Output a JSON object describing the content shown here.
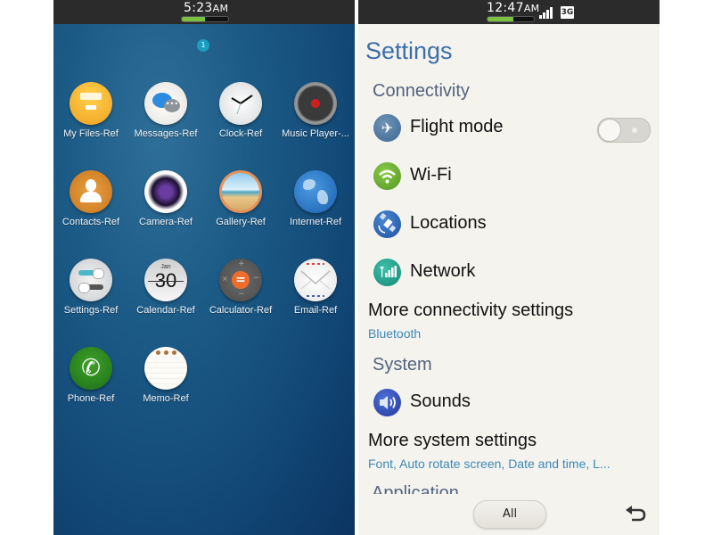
{
  "home_screen": {
    "status_bar": {
      "time": "5:23",
      "ampm": "AM",
      "battery_percent": 50
    },
    "page_indicator": "1",
    "apps": [
      {
        "label": "My Files-Ref",
        "icon": "folder-icon"
      },
      {
        "label": "Messages-Ref",
        "icon": "chat-bubbles-icon"
      },
      {
        "label": "Clock-Ref",
        "icon": "clock-icon"
      },
      {
        "label": "Music Player-...",
        "icon": "music-player-icon"
      },
      {
        "label": "Contacts-Ref",
        "icon": "contact-person-icon"
      },
      {
        "label": "Camera-Ref",
        "icon": "camera-lens-icon"
      },
      {
        "label": "Gallery-Ref",
        "icon": "gallery-beach-icon"
      },
      {
        "label": "Internet-Ref",
        "icon": "globe-icon"
      },
      {
        "label": "Settings-Ref",
        "icon": "settings-toggles-icon"
      },
      {
        "label": "Calendar-Ref",
        "icon": "calendar-icon",
        "month": "Jan",
        "day": "30"
      },
      {
        "label": "Calculator-Ref",
        "icon": "calculator-icon"
      },
      {
        "label": "Email-Ref",
        "icon": "envelope-icon"
      },
      {
        "label": "Phone-Ref",
        "icon": "phone-icon"
      },
      {
        "label": "Memo-Ref",
        "icon": "memo-notepad-icon"
      }
    ]
  },
  "settings_screen": {
    "status_bar": {
      "time": "12:47",
      "ampm": "AM",
      "network": "3G",
      "battery_percent": 55
    },
    "title": "Settings",
    "connectivity": {
      "header": "Connectivity",
      "items": [
        {
          "label": "Flight mode",
          "toggle_on": false
        },
        {
          "label": "Wi-Fi"
        },
        {
          "label": "Locations"
        },
        {
          "label": "Network"
        }
      ],
      "more_label": "More connectivity settings",
      "more_sub": "Bluetooth"
    },
    "system": {
      "header": "System",
      "items": [
        {
          "label": "Sounds"
        }
      ],
      "more_label": "More system settings",
      "more_sub": "Font, Auto rotate screen, Date and time, L..."
    },
    "application_header": "Application",
    "bottom_bar": {
      "all_label": "All"
    },
    "colors": {
      "title": "#3c6fa8",
      "section": "#53637d",
      "link": "#3a8ab8"
    }
  }
}
